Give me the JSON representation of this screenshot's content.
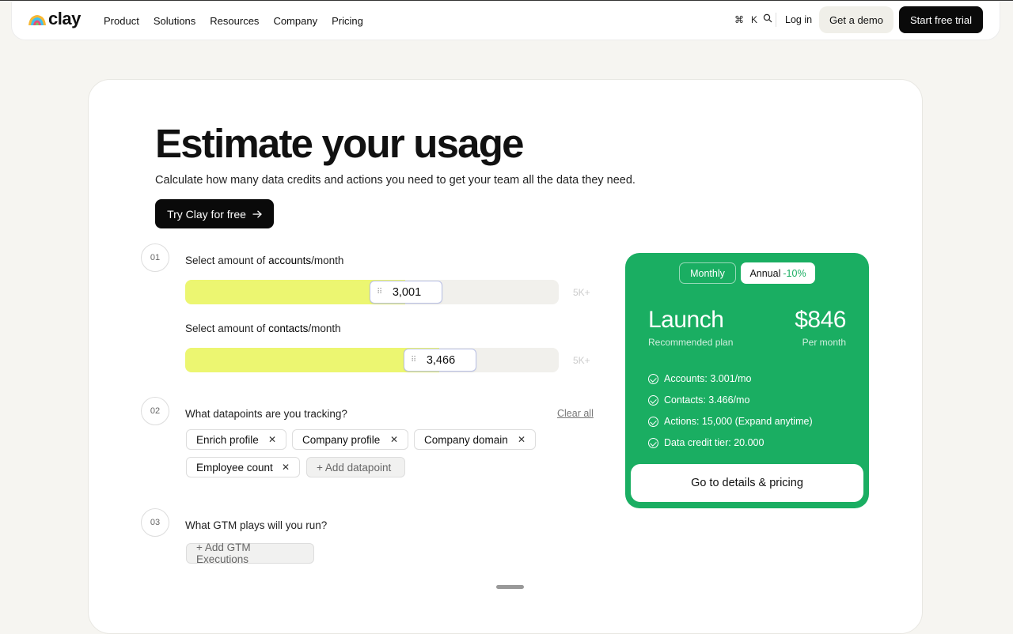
{
  "nav": {
    "logo_text": "clay",
    "links": [
      "Product",
      "Solutions",
      "Resources",
      "Company",
      "Pricing"
    ],
    "shortcut_key_1": "⌘",
    "shortcut_key_2": "K",
    "login": "Log in",
    "demo": "Get a demo",
    "trial": "Start free trial"
  },
  "hero": {
    "title": "Estimate your usage",
    "subtitle": "Calculate how many data credits and actions you need to get your team all the data they need.",
    "cta": "Try Clay for free",
    "cta_icon": "arrow-right-icon"
  },
  "step1": {
    "num": "01",
    "accounts_prefix": "Select amount of ",
    "accounts_bold": "accounts",
    "accounts_suffix": "/month",
    "accounts_value": "3,001",
    "accounts_fraction": 0.59,
    "accounts_max": "5K+",
    "contacts_prefix": "Select amount of ",
    "contacts_bold": "contacts",
    "contacts_suffix": "/month",
    "contacts_value": "3,466",
    "contacts_fraction": 0.68,
    "contacts_max": "5K+"
  },
  "step2": {
    "num": "02",
    "question": "What datapoints are you tracking?",
    "clear": "Clear all",
    "chips": [
      "Enrich profile",
      "Company profile",
      "Company domain",
      "Employee count"
    ],
    "add": "+ Add datapoint"
  },
  "step3": {
    "num": "03",
    "question": "What GTM plays will you run?",
    "add": "+ Add GTM Executions"
  },
  "pricing": {
    "monthly": "Monthly",
    "annual": "Annual",
    "annual_discount": "-10%",
    "plan": "Launch",
    "plan_sub": "Recommended plan",
    "price": "$846",
    "price_sub": "Per month",
    "features": [
      "Accounts: 3.001/mo",
      "Contacts: 3.466/mo",
      "Actions: 15,000 (Expand anytime)",
      "Data credit tier: 20.000"
    ],
    "cta": "Go to details & pricing",
    "accent": "#1aae62"
  },
  "colors": {
    "slider_fill": "#ecf671",
    "background": "#f6f5f1"
  }
}
